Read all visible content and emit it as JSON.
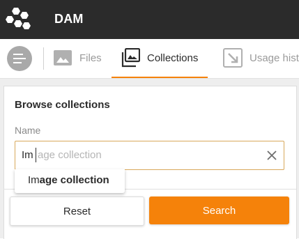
{
  "header": {
    "title": "DAM",
    "logo_icon": "hexagon-cluster-logo",
    "background": "#2b2b2b"
  },
  "nav": {
    "menu_icon": "menu-lines-icon",
    "tabs": [
      {
        "label": "Files",
        "icon": "image-icon",
        "active": false
      },
      {
        "label": "Collections",
        "icon": "image-stack-icon",
        "active": true
      },
      {
        "label": "Usage hist",
        "icon": "usage-arrow-icon",
        "active": false
      }
    ],
    "accent": "#f5820a"
  },
  "panel": {
    "title": "Browse collections",
    "name_label": "Name",
    "name_value": "Im",
    "name_ghost": "age collection",
    "clear_icon": "close-icon",
    "suggestion": {
      "prefix": "Im",
      "rest": "age collection"
    },
    "reset_label": "Reset",
    "search_label": "Search"
  }
}
